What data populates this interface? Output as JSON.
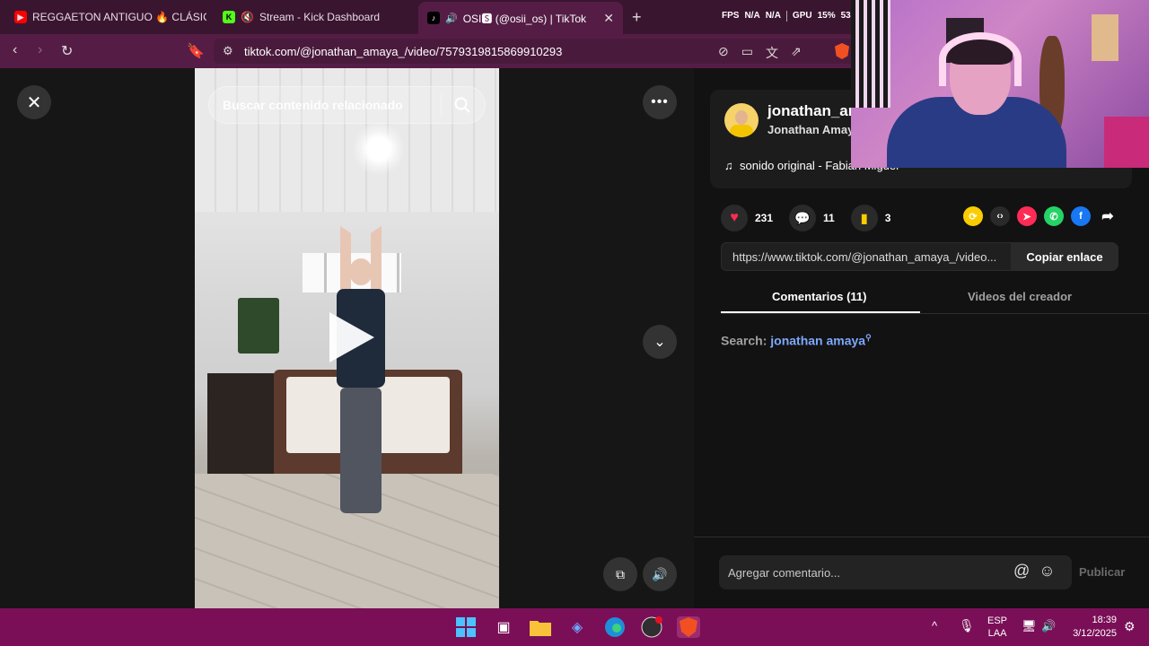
{
  "browser": {
    "tabs": [
      {
        "title": "REGGAETON ANTIGUO 🔥 CLÁSICOS",
        "icon": "youtube-icon"
      },
      {
        "title": "Stream - Kick Dashboard",
        "icon": "kick-icon",
        "muted": true
      },
      {
        "title": "OSI🆂 (@osii_os) | TikTok",
        "icon": "tiktok-icon",
        "active": true
      }
    ],
    "hud": {
      "fps_label": "FPS",
      "fps_value": "N/A",
      "fps_value2": "N/A",
      "gpu_label": "GPU",
      "gpu_value": "15%",
      "gpu_value2": "53°"
    },
    "url": "tiktok.com/@jonathan_amaya_/video/7579319815869910293"
  },
  "video": {
    "search_placeholder": "Buscar contenido relacionado"
  },
  "creator": {
    "username": "jonathan_amaya_",
    "nickname": "Jonathan Amaya",
    "music": "sonido original - Fabian Miguel"
  },
  "stats": {
    "likes": "231",
    "comments": "11",
    "saves": "3"
  },
  "link": {
    "url": "https://www.tiktok.com/@jonathan_amaya_/video...",
    "copy_label": "Copiar enlace"
  },
  "panel_tabs": {
    "comments_label": "Comentarios (11)",
    "creator_videos_label": "Videos del creador"
  },
  "related_search": {
    "prefix": "Search:",
    "query": "jonathan amaya"
  },
  "comment_box": {
    "placeholder": "Agregar comentario...",
    "publish_label": "Publicar"
  },
  "taskbar": {
    "lang_top": "ESP",
    "lang_bottom": "LAA",
    "time": "18:39",
    "date": "3/12/2025"
  },
  "colors": {
    "like": "#fe2c55",
    "save": "#facd00",
    "link_blue": "#7da8ff",
    "tabbar": "#3a1530",
    "taskbar": "#7a0f57"
  }
}
